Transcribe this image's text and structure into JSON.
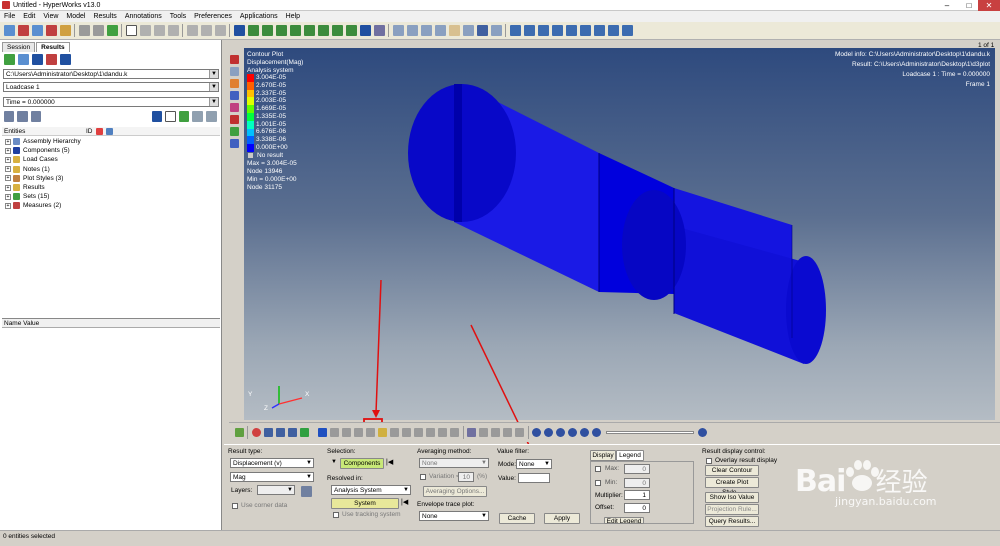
{
  "app": {
    "title": "Untitled - HyperWorks v13.0"
  },
  "menu": [
    "File",
    "Edit",
    "View",
    "Model",
    "Results",
    "Annotations",
    "Tools",
    "Preferences",
    "Applications",
    "Help"
  ],
  "page_counter": "1 of 1",
  "left": {
    "tabs": [
      "Session",
      "Results"
    ],
    "file_path": "C:\\Users\\Administrator\\Desktop\\1\\dandu.k",
    "loadcase": "Loadcase 1",
    "time": "Time = 0.000000",
    "entities_label": "Entities",
    "entities_id": "ID",
    "tree": [
      {
        "label": "Assembly Hierarchy",
        "color": "#6b8cc4"
      },
      {
        "label": "Components (5)",
        "color": "#2040a0"
      },
      {
        "label": "Load Cases",
        "color": "#d8b040"
      },
      {
        "label": "Notes (1)",
        "color": "#d8b040"
      },
      {
        "label": "Plot Styles (3)",
        "color": "#c08040"
      },
      {
        "label": "Results",
        "color": "#d8b040"
      },
      {
        "label": "Sets (15)",
        "color": "#40a040"
      },
      {
        "label": "Measures (2)",
        "color": "#c04040"
      }
    ],
    "name_value_header": "Name Value"
  },
  "viewport": {
    "plot_title": "Contour Plot",
    "plot_sub1": "Displacement(Mag)",
    "plot_sub2": "Analysis system",
    "legend": [
      {
        "label": "3.004E-05",
        "color": "#ff0000"
      },
      {
        "label": "2.670E-05",
        "color": "#ff6000"
      },
      {
        "label": "2.337E-05",
        "color": "#ffc000"
      },
      {
        "label": "2.003E-05",
        "color": "#e0ff00"
      },
      {
        "label": "1.669E-05",
        "color": "#60ff00"
      },
      {
        "label": "1.335E-05",
        "color": "#00ff40"
      },
      {
        "label": "1.001E-05",
        "color": "#00ffc0"
      },
      {
        "label": "6.676E-06",
        "color": "#00c0ff"
      },
      {
        "label": "3.338E-06",
        "color": "#0060ff"
      },
      {
        "label": "0.000E+00",
        "color": "#0000ff"
      }
    ],
    "no_result": "No result",
    "max": "Max = 3.004E-05",
    "max_node": "Node 13946",
    "min": "Min = 0.000E+00",
    "min_node": "Node 31175",
    "model_info": "Model info: C:\\Users\\Administrator\\Desktop\\1\\dandu.k",
    "result": "Result: C:\\Users\\Administrator\\Desktop\\1\\d3plot",
    "loadcase_time": "Loadcase 1 : Time = 0.000000",
    "frame": "Frame 1",
    "axis_y": "Y",
    "axis_x": "X",
    "axis_z": "Z"
  },
  "panel": {
    "result_type_label": "Result type:",
    "result_type": "Displacement (v)",
    "component": "Mag",
    "layers_label": "Layers:",
    "use_corner_data": "Use corner data",
    "selection_label": "Selection:",
    "selection_button": "Components",
    "resolved_label": "Resolved in:",
    "resolved": "Analysis System",
    "system_button": "System",
    "use_tracking": "Use tracking system",
    "averaging_label": "Averaging method:",
    "averaging": "None",
    "variation_label": "Variation <",
    "variation_value": "10",
    "variation_unit": "(%)",
    "averaging_options": "Averaging Options...",
    "envelope_label": "Envelope trace plot:",
    "envelope": "None",
    "value_filter_label": "Value filter:",
    "mode_label": "Mode:",
    "mode": "None",
    "value_label": "Value:",
    "cache_button": "Cache",
    "apply_button": "Apply",
    "tab_display": "Display",
    "tab_legend": "Legend",
    "max_label": "Max:",
    "max_value": "0",
    "min_label": "Min:",
    "min_value": "0",
    "multiplier_label": "Multiplier:",
    "multiplier_value": "1",
    "offset_label": "Offset:",
    "offset_value": "0",
    "edit_legend": "Edit Legend",
    "rdc_label": "Result display control:",
    "overlay": "Overlay result display",
    "clear_contour": "Clear Contour",
    "create_plot_style": "Create Plot Style...",
    "show_iso_value": "Show Iso Value",
    "projection_rule": "Projection Rule...",
    "query_results": "Query Results..."
  },
  "status": {
    "text": "0 entities selected"
  },
  "watermark": {
    "brand": "Bai",
    "cn": "经验",
    "url": "jingyan.baidu.com"
  }
}
